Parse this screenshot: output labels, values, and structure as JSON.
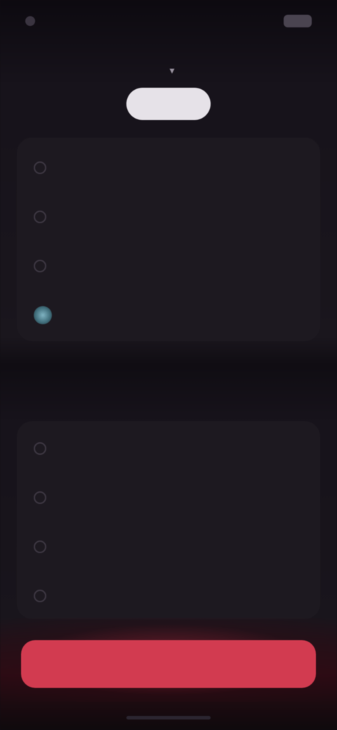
{
  "status_bar": {
    "time": "",
    "battery": ""
  },
  "header": {
    "title": ""
  },
  "tabs": [
    {
      "label": ""
    },
    {
      "label": ""
    },
    {
      "label": ""
    },
    {
      "label": ""
    },
    {
      "label": ""
    }
  ],
  "primary_list": {
    "items": [
      {
        "label": "",
        "selected": false
      },
      {
        "label": "",
        "selected": false
      },
      {
        "label": "",
        "selected": false
      },
      {
        "label": "",
        "selected": true
      }
    ]
  },
  "secondary_section": {
    "label": "",
    "items": [
      {
        "label": ""
      },
      {
        "label": ""
      },
      {
        "label": ""
      },
      {
        "label": ""
      }
    ]
  },
  "cta": {
    "label": ""
  },
  "colors": {
    "background": "#100d13",
    "card": "#1d1920",
    "accent": "#d23b50",
    "selected_icon": "#7fb3c2"
  }
}
